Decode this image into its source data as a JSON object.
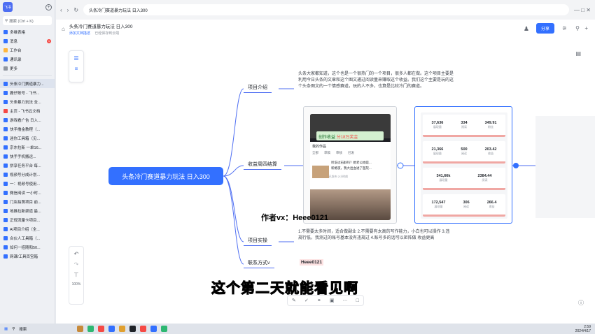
{
  "sidebar": {
    "avatar": "飞书",
    "search": "搜索 (Ctrl + K)",
    "nav": [
      {
        "label": "多维表格",
        "color": "#3370ff"
      },
      {
        "label": "消息",
        "color": "#3370ff",
        "badge": "1"
      },
      {
        "label": "工作台",
        "color": "#ffb63c"
      },
      {
        "label": "通讯录",
        "color": "#3370ff"
      },
      {
        "label": "更多",
        "color": "#8f959e"
      }
    ],
    "docs": [
      {
        "label": "头条冷门赛道暴力...",
        "color": "#3370ff",
        "active": true
      },
      {
        "label": "搬仔账号 - 飞书...",
        "color": "#3370ff"
      },
      {
        "label": "头条暴力玩法 全...",
        "color": "#3370ff"
      },
      {
        "label": "主页 - 飞书云文档",
        "color": "#f54a45"
      },
      {
        "label": "游戏看广告 日入...",
        "color": "#3370ff"
      },
      {
        "label": "快手撸金教程（...",
        "color": "#3370ff"
      },
      {
        "label": "迷你工具箱（见...",
        "color": "#3370ff"
      },
      {
        "label": "京东拉新 一单16...",
        "color": "#3370ff"
      },
      {
        "label": "快手手机搬运...",
        "color": "#3370ff"
      },
      {
        "label": "拼享任务平台 每...",
        "color": "#3370ff"
      },
      {
        "label": "视频号分成计划...",
        "color": "#3370ff"
      },
      {
        "label": "一：视频号使用...",
        "color": "#3370ff"
      },
      {
        "label": "微信阅读 一小时...",
        "color": "#3370ff"
      },
      {
        "label": "门店拍照项目 前...",
        "color": "#3370ff"
      },
      {
        "label": "地推拉新渠道 最...",
        "color": "#3370ff"
      },
      {
        "label": "正规流量卡项目...",
        "color": "#3370ff"
      },
      {
        "label": "AI项目介绍（全...",
        "color": "#3370ff"
      },
      {
        "label": "合伙人工具箱（...",
        "color": "#3370ff"
      },
      {
        "label": "如何一招随和50...",
        "color": "#3370ff"
      },
      {
        "label": "网课/工具百宝箱",
        "color": "#3370ff"
      }
    ]
  },
  "doc": {
    "title": "头条冷门赛道暴力玩法 日入300",
    "add_desc": "添加文档描述",
    "saved": "已经保存到云端",
    "share": "分享"
  },
  "mindmap": {
    "root": "头条冷门赛道暴力玩法 日入300",
    "nodes": {
      "intro": "项目介绍",
      "revenue": "收益周四结算",
      "practice": "项目实操",
      "contact": "联系方式v"
    },
    "intro_text": "头条大家都知道，这个也是一个很热门的一个项目，很多人都在做。这个项目主要是利用今日头条的文章和这个图文通过阅读量来赚取这个收益。我们这个主要是玩的这个头条图文的一个情感赛道，玩的人不多，也算是比较冷门的赛道。",
    "practice_text": "1.不需要太多时间，适合做副业 2.不需要有太高的写作能力，小白也可以操作 3.违规行低，我测过的账号基本没有违规过 4.账号多的话可以矩阵做 收益更高",
    "contact_value": "Heee0121"
  },
  "overlay": {
    "author": "作者vx：Heee0121",
    "subtitle": "这个第二天就能看见啊",
    "zoom": "100%"
  },
  "phone": {
    "banner": "创作收益",
    "banner_amount": "分18万奖金",
    "tabs": [
      "我的作品",
      "全部",
      "草稿",
      "审核",
      "已发"
    ],
    "line1": "听说过石斛吗？她老公她是...",
    "line2": "新婚夜，我大出血进了医院...",
    "footer": "看123次播放 已发布 2小时前"
  },
  "stats": {
    "top": [
      {
        "label": "展现量",
        "value": "37,636"
      },
      {
        "label": "阅读",
        "value": "334"
      },
      {
        "label": "粉丝",
        "value": "349.91"
      }
    ],
    "mid": [
      {
        "label": "展现量",
        "value": "21,366"
      },
      {
        "label": "阅读",
        "value": "500"
      },
      {
        "label": "收益",
        "value": "203.42"
      }
    ],
    "bottom": [
      {
        "label": "展现量",
        "value": "341,66k"
      },
      {
        "label": "阅读",
        "value": "2384.44"
      }
    ],
    "bottom2": [
      {
        "label": "展现量",
        "value": "172,547"
      },
      {
        "label": "阅读",
        "value": "306"
      },
      {
        "label": "收益",
        "value": "266.4"
      }
    ]
  },
  "taskbar": {
    "search": "搜索",
    "time": "2:59",
    "date": "2024/4/17"
  }
}
